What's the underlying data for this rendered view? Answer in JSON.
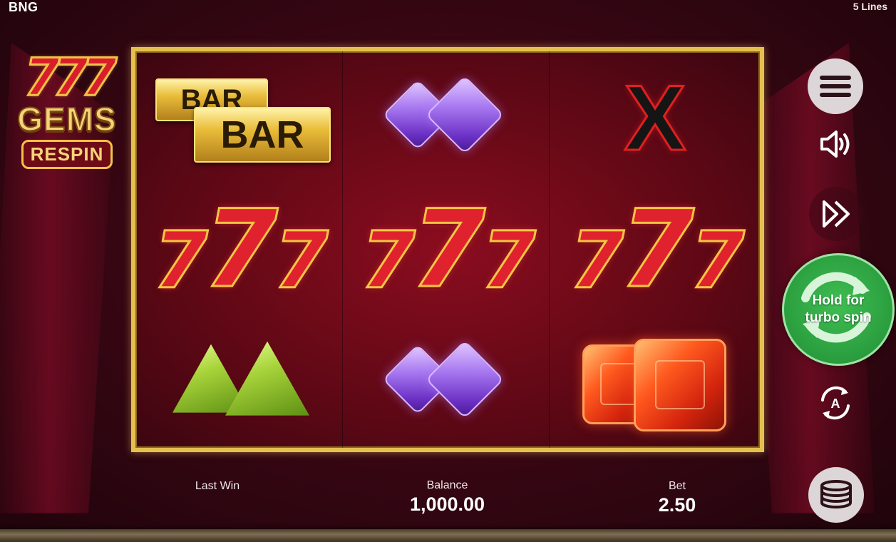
{
  "topbar": {
    "brand": "BNG",
    "lines": "5 Lines"
  },
  "logo": {
    "line1": "777",
    "line2": "GEMS",
    "line3": "RESPIN"
  },
  "reels": [
    [
      "bar-bar",
      "sevens",
      "green-triangle-gems"
    ],
    [
      "purple-diamond-gems",
      "sevens",
      "purple-diamond-gems"
    ],
    [
      "red-x",
      "sevens",
      "orange-ruby-gems"
    ]
  ],
  "symbols": {
    "bar_text": "BAR",
    "seven": "7",
    "x": "X"
  },
  "controls": {
    "menu_icon": "hamburger-menu-icon",
    "sound_icon": "speaker-icon",
    "fast_forward_icon": "fast-forward-icon",
    "spin_label_line1": "Hold for",
    "spin_label_line2": "turbo spin",
    "autoplay_letter": "A",
    "bet_icon": "coin-stack-icon"
  },
  "info": {
    "last_win_label": "Last Win",
    "balance_label": "Balance",
    "balance_value": "1,000.00",
    "bet_label": "Bet",
    "bet_value": "2.50"
  },
  "colors": {
    "frame_gold": "#e6c04e",
    "spin_green": "#2a9d3e",
    "bg_maroon": "#3a0714"
  }
}
